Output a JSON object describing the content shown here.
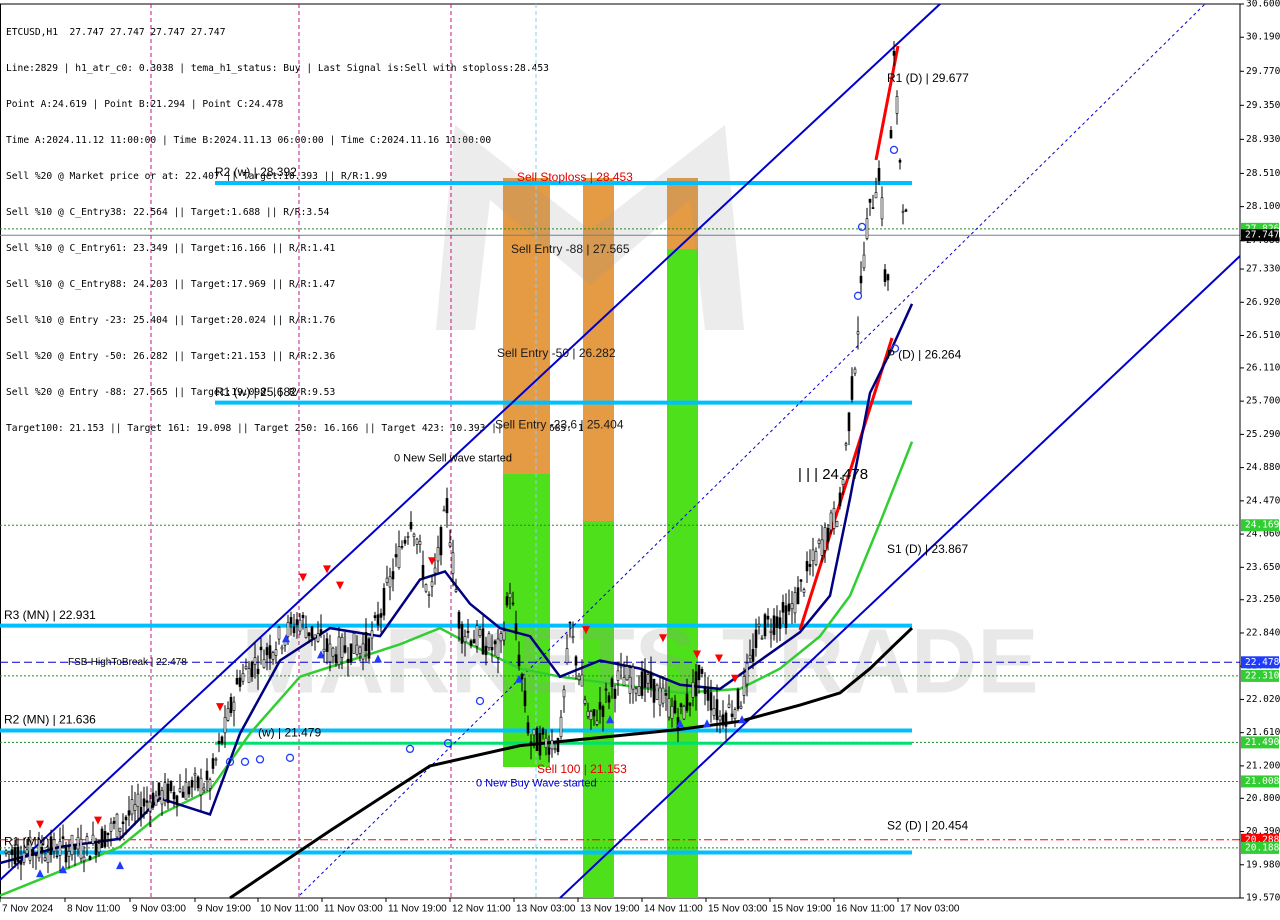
{
  "header": {
    "title": "ETCUSD,H1  27.747 27.747 27.747 27.747",
    "lines": [
      "Line:2829 | h1_atr_c0: 0.3038 | tema_h1_status: Buy | Last Signal is:Sell with stoploss:28.453",
      "Point A:24.619 | Point B:21.294 | Point C:24.478",
      "Time A:2024.11.12 11:00:00 | Time B:2024.11.13 06:00:00 | Time C:2024.11.16 11:00:00",
      "Sell %20 @ Market price or at: 22.407 || Target:10.393 || R/R:1.99",
      "Sell %10 @ C_Entry38: 22.564 || Target:1.688 || R/R:3.54",
      "Sell %10 @ C_Entry61: 23.349 || Target:16.166 || R/R:1.41",
      "Sell %10 @ C_Entry88: 24.203 || Target:17.969 || R/R:1.47",
      "Sell %10 @ Entry -23: 25.404 || Target:20.024 || R/R:1.76",
      "Sell %20 @ Entry -50: 26.282 || Target:21.153 || R/R:2.36",
      "Sell %20 @ Entry -88: 27.565 || Target:19.098 || R/R:9.53",
      "Target100: 21.153 || Target 161: 19.098 || Target 250: 16.166 || Target 423: 10.393 || Target 685: 1.688"
    ]
  },
  "watermark": "MARKETS TRADE",
  "colors": {
    "level_line": "#00bfff",
    "channel": "#0000cd",
    "ma_navy": "#000080",
    "ma_green": "#32cd32",
    "ma_black": "#000000",
    "orange_zone": "#e59a44",
    "green_zone": "#4ee01a",
    "red_line": "#ff0000",
    "candle": "#000000",
    "price_tag": "#000000",
    "level_tag": "#32cd32",
    "blue_tag": "#1e3cff",
    "red_tag": "#ff0000"
  },
  "chart_data": {
    "type": "candlestick",
    "symbol": "ETCUSD",
    "timeframe": "H1",
    "ylim": [
      19.57,
      30.6
    ],
    "y_ticks": [
      "30.600",
      "30.190",
      "29.770",
      "29.350",
      "28.930",
      "28.510",
      "28.100",
      "27.680",
      "27.330",
      "26.920",
      "26.510",
      "26.110",
      "25.700",
      "25.290",
      "24.880",
      "24.470",
      "24.060",
      "23.650",
      "23.250",
      "22.840",
      "22.430",
      "22.020",
      "21.610",
      "21.200",
      "20.800",
      "20.390",
      "19.980",
      "19.570"
    ],
    "x_ticks": [
      "7 Nov 2024",
      "8 Nov 11:00",
      "9 Nov 03:00",
      "9 Nov 19:00",
      "10 Nov 11:00",
      "11 Nov 03:00",
      "11 Nov 19:00",
      "12 Nov 11:00",
      "13 Nov 03:00",
      "13 Nov 19:00",
      "14 Nov 11:00",
      "15 Nov 03:00",
      "15 Nov 19:00",
      "16 Nov 11:00",
      "17 Nov 03:00"
    ],
    "price_tags": [
      {
        "value": 27.826,
        "label": "27.826",
        "style": "level"
      },
      {
        "value": 27.747,
        "label": "27.747",
        "style": "price"
      },
      {
        "value": 24.169,
        "label": "24.169",
        "style": "level"
      },
      {
        "value": 22.478,
        "label": "22.478",
        "style": "blue"
      },
      {
        "value": 22.31,
        "label": "22.310",
        "style": "level"
      },
      {
        "value": 21.49,
        "label": "21.490",
        "style": "level"
      },
      {
        "value": 21.008,
        "label": "21.008",
        "style": "level"
      },
      {
        "value": 20.288,
        "label": "20.288",
        "style": "red"
      },
      {
        "value": 20.188,
        "label": "20.188",
        "style": "level"
      }
    ],
    "levels": [
      {
        "label": "R2 (w) | 28.392",
        "value": 28.392,
        "kind": "weekly"
      },
      {
        "label": "R1 (w) | 25.682",
        "value": 25.682,
        "kind": "weekly"
      },
      {
        "label": "R3 (MN) | 22.931",
        "value": 22.931,
        "kind": "monthly"
      },
      {
        "label": "R2 (MN) | 21.636",
        "value": 21.636,
        "kind": "monthly"
      },
      {
        "label": "R1 (MN)",
        "value": 20.131,
        "kind": "monthly"
      },
      {
        "label": "FSB-HighToBreak | 22.478",
        "value": 22.478,
        "kind": "fsb"
      },
      {
        "label": "(w) | 21.479",
        "value": 21.479,
        "kind": "weekly-small"
      }
    ],
    "daily_labels": [
      {
        "label": "R1 (D) | 29.677",
        "value": 29.677
      },
      {
        "label": "P (D) | 26.264",
        "value": 26.264
      },
      {
        "label": "S1 (D) | 23.867",
        "value": 23.867
      },
      {
        "label": "S2 (D) | 20.454",
        "value": 20.454
      }
    ],
    "zone_labels": [
      {
        "label": "Sell Stoploss | 28.453",
        "value": 28.453,
        "color": "red"
      },
      {
        "label": "Sell Entry -88 | 27.565",
        "value": 27.565,
        "color": "dark"
      },
      {
        "label": "Sell Entry -50 | 26.282",
        "value": 26.282,
        "color": "dark"
      },
      {
        "label": "Sell Entry -23.6 | 25.404",
        "value": 25.404,
        "color": "dark"
      },
      {
        "label": "Sell 100 | 21.153",
        "value": 21.153,
        "color": "red"
      }
    ],
    "annotations": [
      {
        "label": "0 New Sell wave started"
      },
      {
        "label": "0 New Buy Wave started"
      },
      {
        "label": "| | | 24.478"
      }
    ],
    "close": 27.747
  }
}
